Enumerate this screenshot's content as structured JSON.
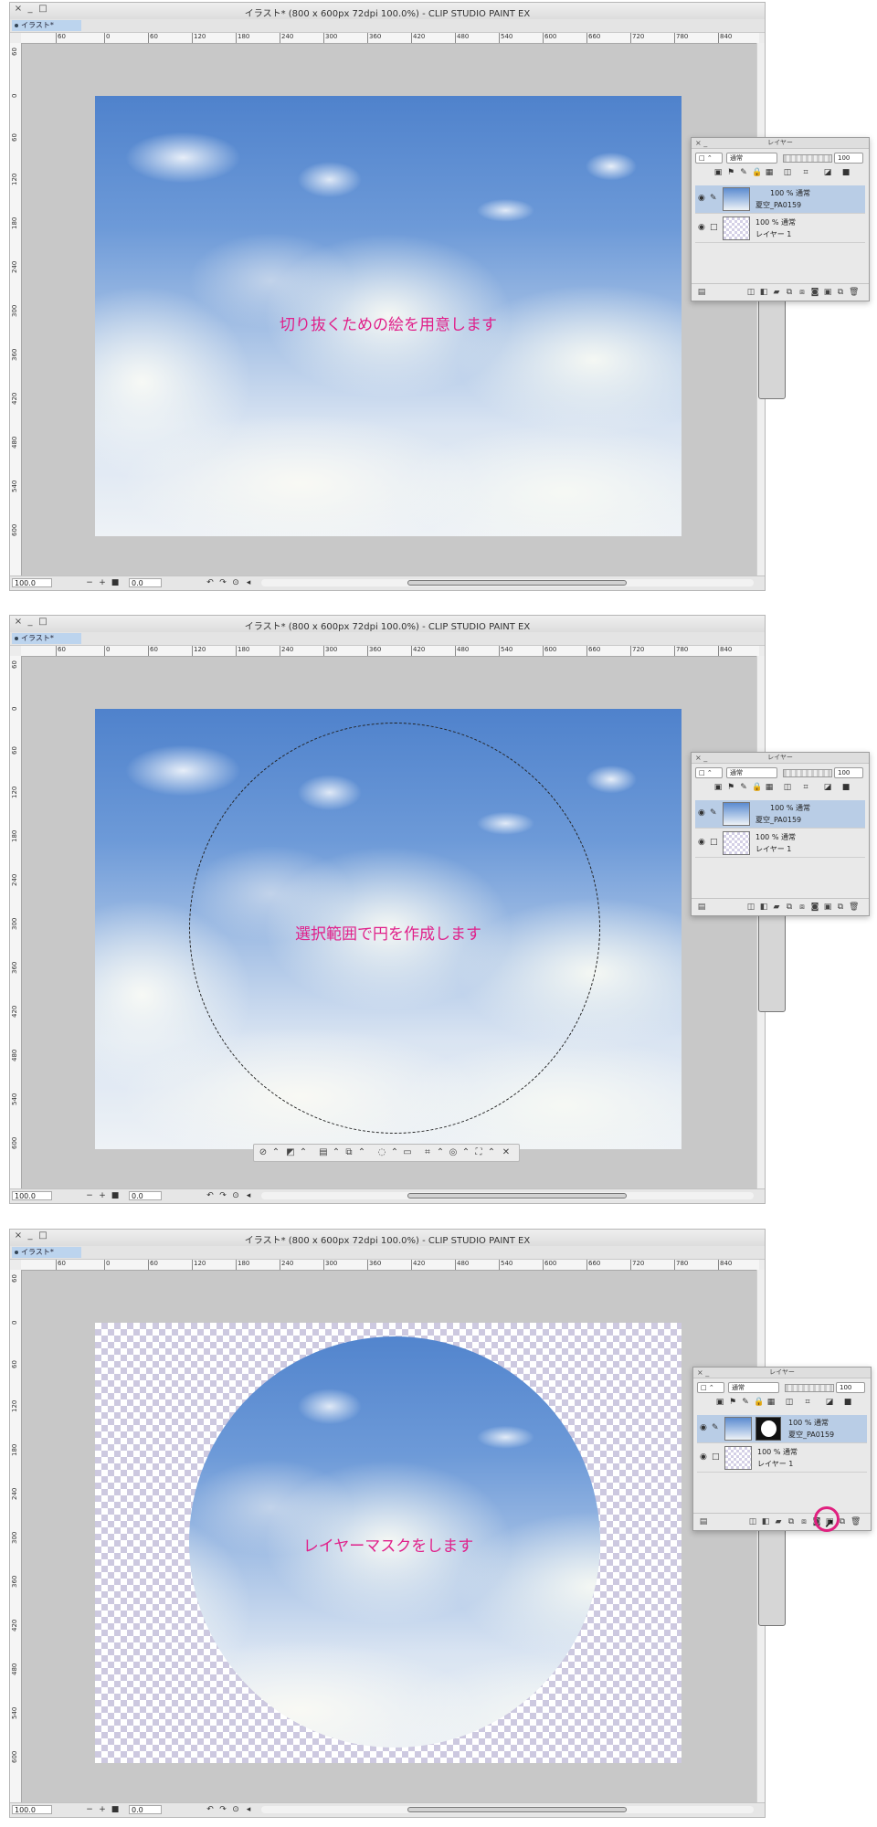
{
  "window": {
    "title": "イラスト* (800 x 600px 72dpi 100.0%)  - CLIP STUDIO PAINT EX",
    "tab_label": "イラスト*",
    "zoom_value": "100.0",
    "angle_value": "0.0",
    "ruler_h_ticks": [
      "60",
      "0",
      "60",
      "120",
      "180",
      "240",
      "300",
      "360",
      "420",
      "480",
      "540",
      "600",
      "660",
      "720",
      "780",
      "840"
    ],
    "ruler_v_ticks": [
      "60",
      "0",
      "60",
      "120",
      "180",
      "240",
      "300",
      "360",
      "420",
      "480",
      "540",
      "600"
    ]
  },
  "steps": [
    {
      "caption": "切り抜くための絵を用意します"
    },
    {
      "caption": "選択範囲で円を作成します"
    },
    {
      "caption": "レイヤーマスクをします"
    }
  ],
  "layer_panel": {
    "title": "レイヤー",
    "blend_mode": "通常",
    "opacity": "100",
    "layers": [
      {
        "line1": "100 % 通常",
        "line2": "夏空_PA0159"
      },
      {
        "line1": "100 % 通常",
        "line2": "レイヤー 1"
      }
    ]
  },
  "colors": {
    "caption": "#e0208a",
    "selection_highlight": "#b9cde6",
    "tab_active": "#bcd4ee"
  },
  "icons": {
    "close": "×",
    "minimize": "_",
    "maximize": "□",
    "eye": "eye-icon",
    "pen": "pen-icon"
  }
}
